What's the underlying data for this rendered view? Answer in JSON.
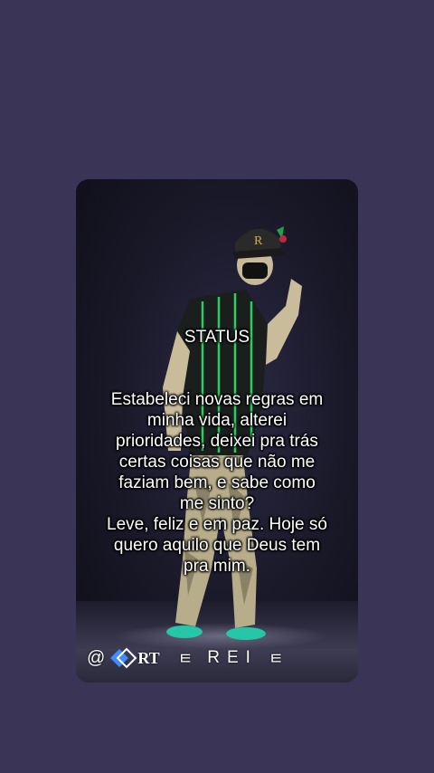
{
  "story": {
    "title": "STATUS",
    "body": "Estabeleci novas regras em\nminha vida, alterei\nprioridades, deixei pra trás\ncertas coisas que não me\nfaziam bem, e sabe como\nme sinto?\nLeve, feliz e em paz. Hoje só\nquero aquilo que Deus tem\npra mim."
  },
  "watermark": {
    "at": "@",
    "logo_icon": "diamond-logo-icon",
    "brand": "RT",
    "symbol_left": "ㅌ",
    "name": "REI",
    "symbol_right": "ㅌ"
  },
  "colors": {
    "background": "#3a3457",
    "accent_green": "#2ee06a",
    "logo_blue": "#3f8cff"
  }
}
